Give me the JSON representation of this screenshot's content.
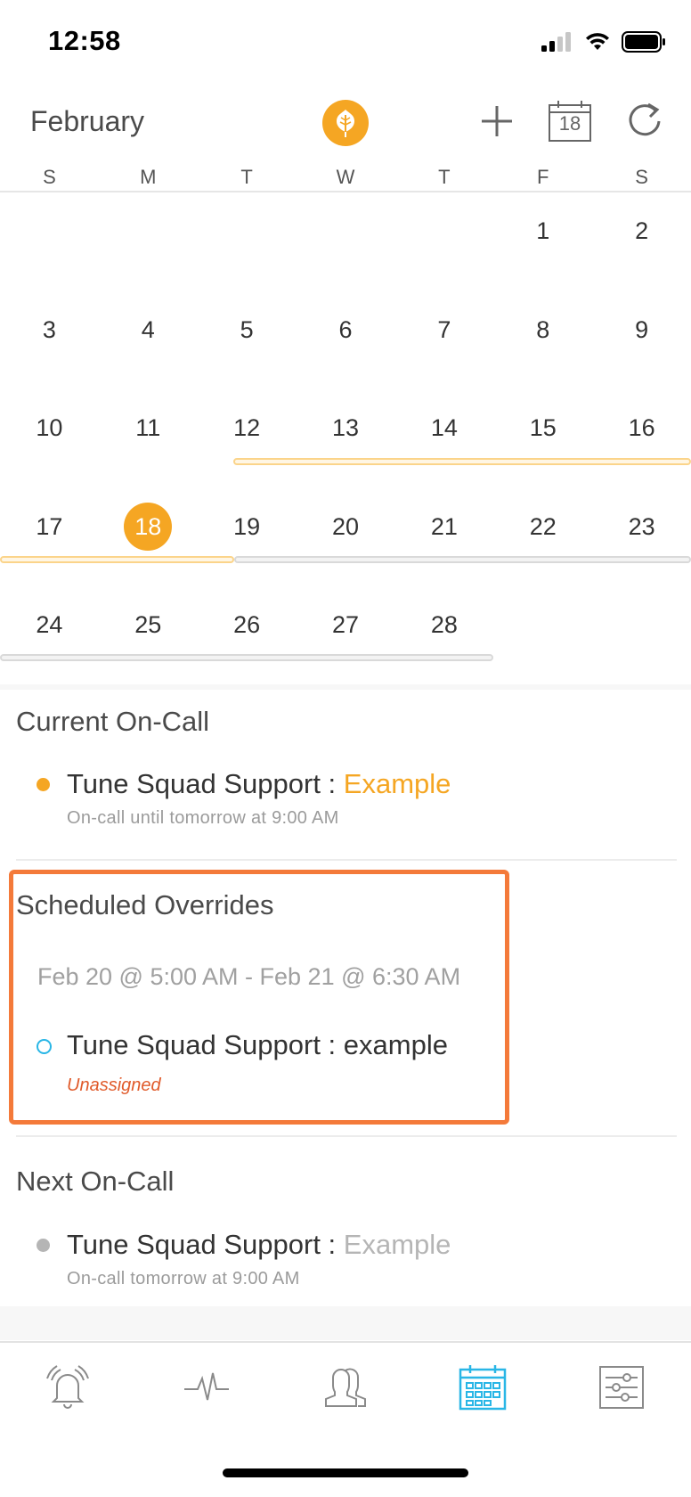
{
  "status_bar": {
    "time": "12:58"
  },
  "header": {
    "month": "February",
    "calendar_button_day": "18",
    "icons": [
      "brand-leaf-icon",
      "plus-icon",
      "calendar-today-icon",
      "refresh-icon"
    ],
    "accent_color": "#f5a623"
  },
  "calendar": {
    "weekdays": [
      "S",
      "M",
      "T",
      "W",
      "T",
      "F",
      "S"
    ],
    "weeks": [
      [
        "",
        "",
        "",
        "",
        "",
        "1",
        "2"
      ],
      [
        "3",
        "4",
        "5",
        "6",
        "7",
        "8",
        "9"
      ],
      [
        "10",
        "11",
        "12",
        "13",
        "14",
        "15",
        "16"
      ],
      [
        "17",
        "18",
        "19",
        "20",
        "21",
        "22",
        "23"
      ],
      [
        "24",
        "25",
        "26",
        "27",
        "28",
        "",
        ""
      ]
    ],
    "today": "18"
  },
  "current_oncall": {
    "title": "Current On-Call",
    "schedule": "Tune Squad Support : ",
    "person": "Example",
    "subtitle": "On-call until tomorrow at 9:00 AM",
    "dot_color": "#f5a623"
  },
  "scheduled_overrides": {
    "title": "Scheduled Overrides",
    "range": "Feb 20 @ 5:00 AM - Feb 21 @ 6:30 AM",
    "schedule": "Tune Squad Support : example",
    "status": "Unassigned",
    "highlight_color": "#f47a3a"
  },
  "next_oncall": {
    "title": "Next On-Call",
    "schedule": "Tune Squad Support : ",
    "person": "Example",
    "subtitle": "On-call tomorrow at 9:00 AM"
  },
  "tabbar": {
    "tabs": [
      "alerts-bell-icon",
      "pulse-icon",
      "people-icon",
      "calendar-icon",
      "settings-sliders-icon"
    ],
    "active": "calendar-icon",
    "active_color": "#29b6e6"
  }
}
